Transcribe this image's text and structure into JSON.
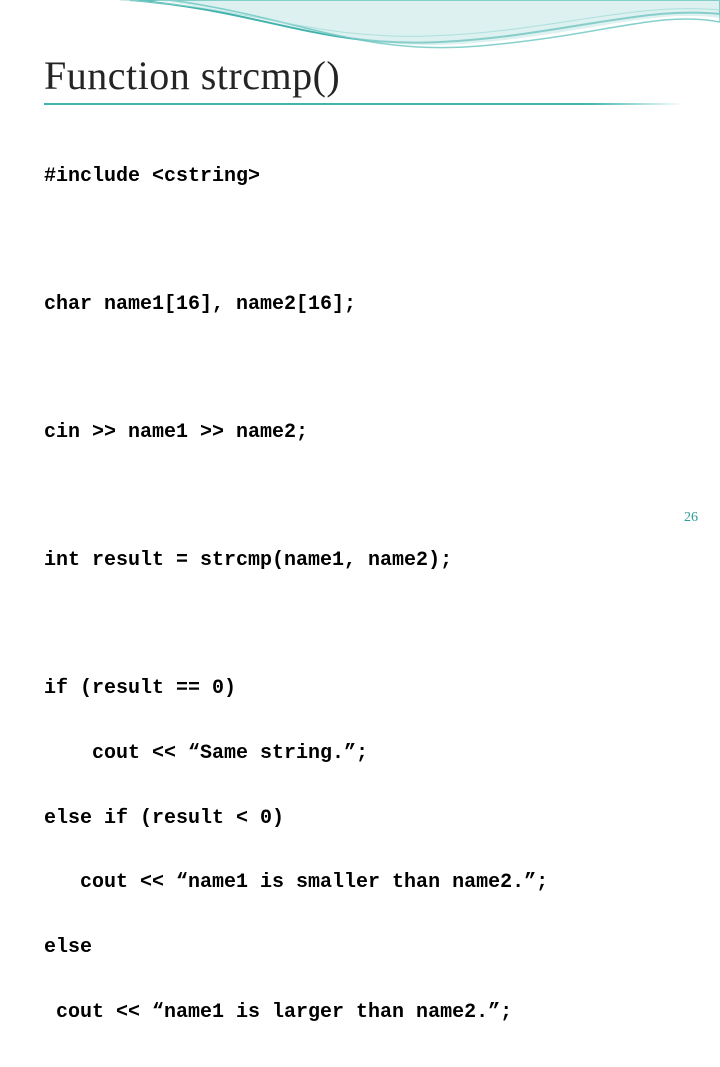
{
  "title": "Function strcmp()",
  "code": {
    "l1": "#include <cstring>",
    "l2": "char name1[16], name2[16];",
    "l3": "cin >> name1 >> name2;",
    "l4": "int result = strcmp(name1, name2);",
    "l5": "if (result == 0)",
    "l6": "    cout << “Same string.”;",
    "l7": "else if (result < 0)",
    "l8": "   cout << “name1 is smaller than name2.”;",
    "l9": "else",
    "l10": " cout << “name1 is larger than name2.”;"
  },
  "page_number": "26"
}
